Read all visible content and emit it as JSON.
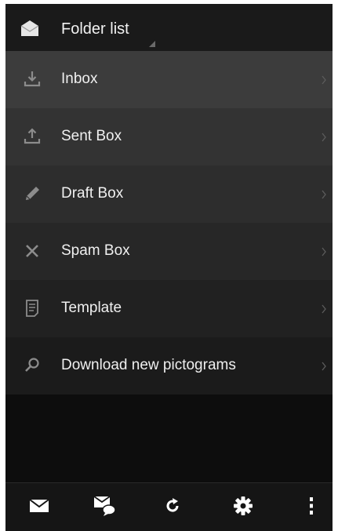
{
  "header": {
    "title": "Folder list",
    "icon": "envelope-icon"
  },
  "menu": {
    "items": [
      {
        "label": "Inbox",
        "icon": "download-tray-icon",
        "background": "#3c3c3c"
      },
      {
        "label": "Sent Box",
        "icon": "upload-tray-icon",
        "background": "#333333"
      },
      {
        "label": "Draft Box",
        "icon": "pencil-icon",
        "background": "#2d2d2d"
      },
      {
        "label": "Spam Box",
        "icon": "x-icon",
        "background": "#272727"
      },
      {
        "label": "Template",
        "icon": "document-icon",
        "background": "#212121"
      },
      {
        "label": "Download new pictograms",
        "icon": "search-icon",
        "background": "#1b1b1b"
      }
    ]
  },
  "bottom_bar": {
    "buttons": [
      {
        "icon": "mail-icon"
      },
      {
        "icon": "mail-chat-icon"
      },
      {
        "icon": "refresh-icon"
      },
      {
        "icon": "settings-gear-icon"
      },
      {
        "icon": "more-vertical-icon"
      }
    ]
  },
  "colors": {
    "screen_background": "#0d0d0d",
    "header_background": "#1a1a1a",
    "text": "#f0f0f0",
    "icon": "#8c8c8c"
  }
}
